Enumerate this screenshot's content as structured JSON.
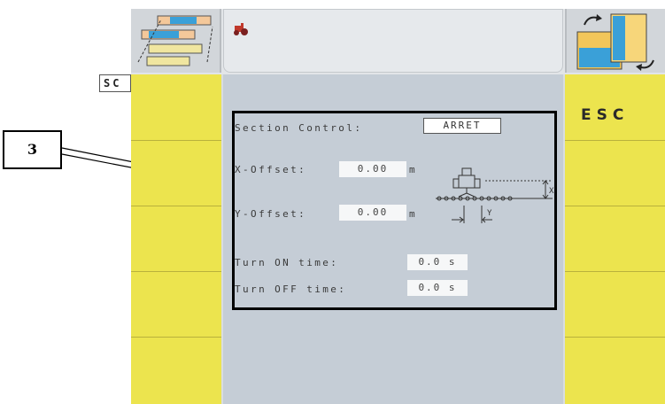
{
  "screen": {
    "sc_tab": "SC",
    "esc_label": "ESC"
  },
  "form": {
    "section_control_label": "Section Control:",
    "section_control_value": "ARRET",
    "x_offset_label": "X-Offset:",
    "x_offset_value": "0.00",
    "x_offset_unit": "m",
    "y_offset_label": "Y-Offset:",
    "y_offset_value": "0.00",
    "y_offset_unit": "m",
    "turn_on_label": "Turn ON time:",
    "turn_on_value": "0.0 s",
    "turn_off_label": "Turn OFF time:",
    "turn_off_value": "0.0 s",
    "diagram_y_label": "Y",
    "diagram_x_label": "X"
  },
  "annotation": {
    "callout_number": "3"
  },
  "icons": {
    "top_left": "section-layout-icon",
    "top_mid": "tractor-icon",
    "top_right": "section-rotate-icon"
  },
  "colors": {
    "softkey_yellow": "#ece44e",
    "content_bg": "#c5cdd6",
    "frame_gray": "#d9dde0"
  }
}
